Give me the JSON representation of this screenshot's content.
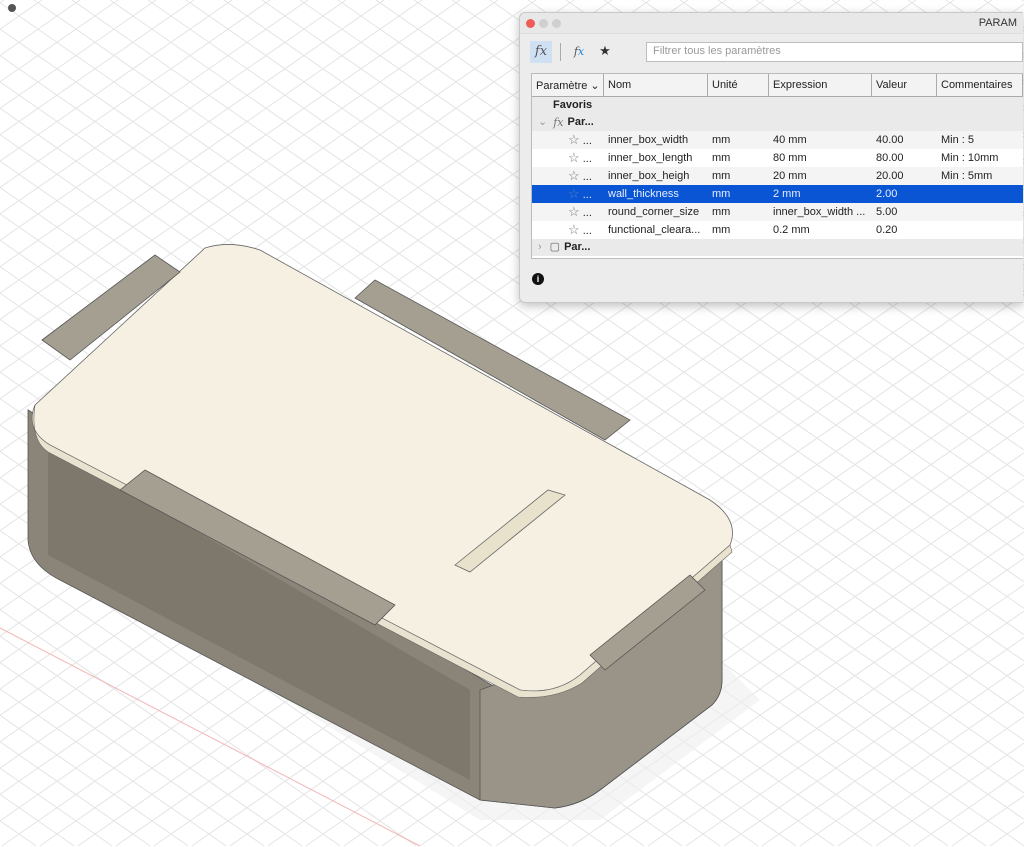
{
  "panel": {
    "title": "PARAM",
    "search_placeholder": "Filtrer tous les paramètres",
    "columns": [
      "Paramètre",
      "Nom",
      "Unité",
      "Expression",
      "Valeur",
      "Commentaires"
    ],
    "favorites_label": "Favoris",
    "user_group_label": "Par...",
    "model_group_label": "Par...",
    "rows": [
      {
        "name": "inner_box_width",
        "unit": "mm",
        "expression": "40 mm",
        "value": "40.00",
        "comment": "Min : 5"
      },
      {
        "name": "inner_box_length",
        "unit": "mm",
        "expression": "80 mm",
        "value": "80.00",
        "comment": "Min : 10mm"
      },
      {
        "name": "inner_box_heigh",
        "unit": "mm",
        "expression": "20 mm",
        "value": "20.00",
        "comment": "Min : 5mm"
      },
      {
        "name": "wall_thickness",
        "unit": "mm",
        "expression": "2 mm",
        "value": "2.00",
        "comment": ""
      },
      {
        "name": "round_corner_size",
        "unit": "mm",
        "expression": "inner_box_width ...",
        "value": "5.00",
        "comment": ""
      },
      {
        "name": "functional_cleara...",
        "unit": "mm",
        "expression": "0.2 mm",
        "value": "0.20",
        "comment": ""
      }
    ],
    "ellipsis": "...",
    "selected_row": "wall_thickness"
  },
  "colors": {
    "selection": "#0a55d4",
    "lid": "#f5f0e1",
    "body": "#8b8579",
    "clip": "#a59f92"
  }
}
